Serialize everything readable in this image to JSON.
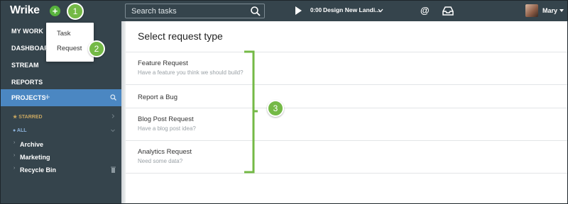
{
  "header": {
    "logo": "Wrike",
    "new_button_symbol": "+",
    "search_placeholder": "Search tasks",
    "timer": "0:00",
    "active_task": "Design New Landi...",
    "user_name": "Mary",
    "at_symbol": "@"
  },
  "dropdown": {
    "items": [
      "Task",
      "Request"
    ]
  },
  "sidebar": {
    "items": [
      "MY WORK",
      "DASHBOARD",
      "STREAM",
      "REPORTS"
    ],
    "projects_label": "PROJECTS",
    "projects_plus": "+",
    "starred_label": "STARRED",
    "all_label": "ALL",
    "folders": [
      "Archive",
      "Marketing",
      "Recycle Bin"
    ]
  },
  "main": {
    "title": "Select request type",
    "requests": [
      {
        "title": "Feature Request",
        "subtitle": "Have a feature you think we should build?"
      },
      {
        "title": "Report a Bug",
        "subtitle": ""
      },
      {
        "title": "Blog Post Request",
        "subtitle": "Have a blog post idea?"
      },
      {
        "title": "Analytics Request",
        "subtitle": "Need some data?"
      }
    ]
  },
  "callouts": [
    "1",
    "2",
    "3"
  ],
  "colors": {
    "topbar": "#35444c",
    "accent_green": "#58b33d",
    "projects_blue": "#4b87c2",
    "callout_green": "#74b946"
  }
}
